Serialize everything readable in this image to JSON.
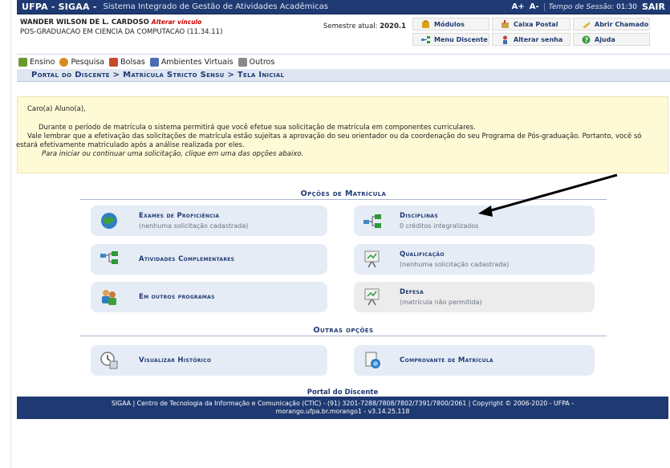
{
  "topbar": {
    "brand": "UFPA - SIGAA -",
    "subtitle": "Sistema Integrado de Gestão de Atividades Acadêmicas",
    "font_inc": "A+",
    "font_dec": "A-",
    "session_label": "Tempo de Sessão:",
    "session_time": "01:30",
    "logout": "SAIR"
  },
  "user": {
    "name": "WANDER WILSON DE L. CARDOSO",
    "alter_link": "Alterar vínculo",
    "course": "POS-GRADUACAO EM CIENCIA DA COMPUTACAO (11.34.11)"
  },
  "semester": {
    "label": "Semestre atual:",
    "value": "2020.1"
  },
  "quick_links": [
    {
      "label": "Módulos",
      "icon": "modules-icon",
      "color": "#d9a21a"
    },
    {
      "label": "Caixa Postal",
      "icon": "mailbox-icon",
      "color": "#c8a24a"
    },
    {
      "label": "Abrir Chamado",
      "icon": "ticket-icon",
      "color": "#e1b12a"
    },
    {
      "label": "Menu Discente",
      "icon": "student-menu-icon",
      "color": "#3f86c9"
    },
    {
      "label": "Alterar senha",
      "icon": "key-icon",
      "color": "#c54040"
    },
    {
      "label": "Ajuda",
      "icon": "help-icon",
      "color": "#3b9b3b"
    }
  ],
  "menu": [
    {
      "label": "Ensino",
      "icon": "teaching-icon",
      "color": "#6a9a2e"
    },
    {
      "label": "Pesquisa",
      "icon": "research-icon",
      "color": "#d48a1e"
    },
    {
      "label": "Bolsas",
      "icon": "scholarship-icon",
      "color": "#c94b2c"
    },
    {
      "label": "Ambientes Virtuais",
      "icon": "virtual-env-icon",
      "color": "#4a6fb0"
    },
    {
      "label": "Outros",
      "icon": "others-icon",
      "color": "#8a8a8a"
    }
  ],
  "breadcrumb": "Portal do Discente > Matrícula Stricto Sensu > Tela Inicial",
  "notice": {
    "greeting": "Caro(a) Aluno(a),",
    "line1": "Durante o período de matrícula o sistema permitirá que você efetue sua solicitação de matrícula em componentes curriculares.",
    "line2": "Vale lembrar que a efetivação das solicitações de matrícula estão sujeitas a aprovação do seu orientador ou da coordenação do seu Programa de Pós-graduação. Portanto, você só estará efetivamente matriculado após a análise realizada por eles.",
    "line3": "Para iniciar ou continuar uma solicitação, clique em uma das opções abaixo."
  },
  "sections": {
    "matricula": "Opções de Matrícula",
    "outras": "Outras opções"
  },
  "options": [
    {
      "title": "Exames de Proficiência",
      "sub": "(nenhuma solicitação cadastrada)",
      "icon": "globe-icon"
    },
    {
      "title": "Disciplinas",
      "sub": "0 créditos integralizados",
      "icon": "network-icon"
    },
    {
      "title": "Atividades Complementares",
      "sub": "",
      "icon": "network-icon"
    },
    {
      "title": "Qualificação",
      "sub": "(nenhuma solicitação cadastrada)",
      "icon": "presentation-icon"
    },
    {
      "title": "Em outros programas",
      "sub": "",
      "icon": "people-icon"
    },
    {
      "title": "Defesa",
      "sub": "(matrícula não permitida)",
      "icon": "presentation-icon"
    }
  ],
  "others": [
    {
      "title": "Visualizar Histórico",
      "icon": "history-icon"
    },
    {
      "title": "Comprovante de Matrícula",
      "icon": "certificate-icon"
    }
  ],
  "portal_footer": "Portal do Discente",
  "footer": {
    "line1": "SIGAA | Centro de Tecnologia da Informação e Comunicação (CTIC) - (91) 3201-7288/7808/7802/7391/7800/2061 | Copyright © 2006-2020 - UFPA -",
    "line2": "morango.ufpa.br.morango1 - v3.14.25.118"
  }
}
